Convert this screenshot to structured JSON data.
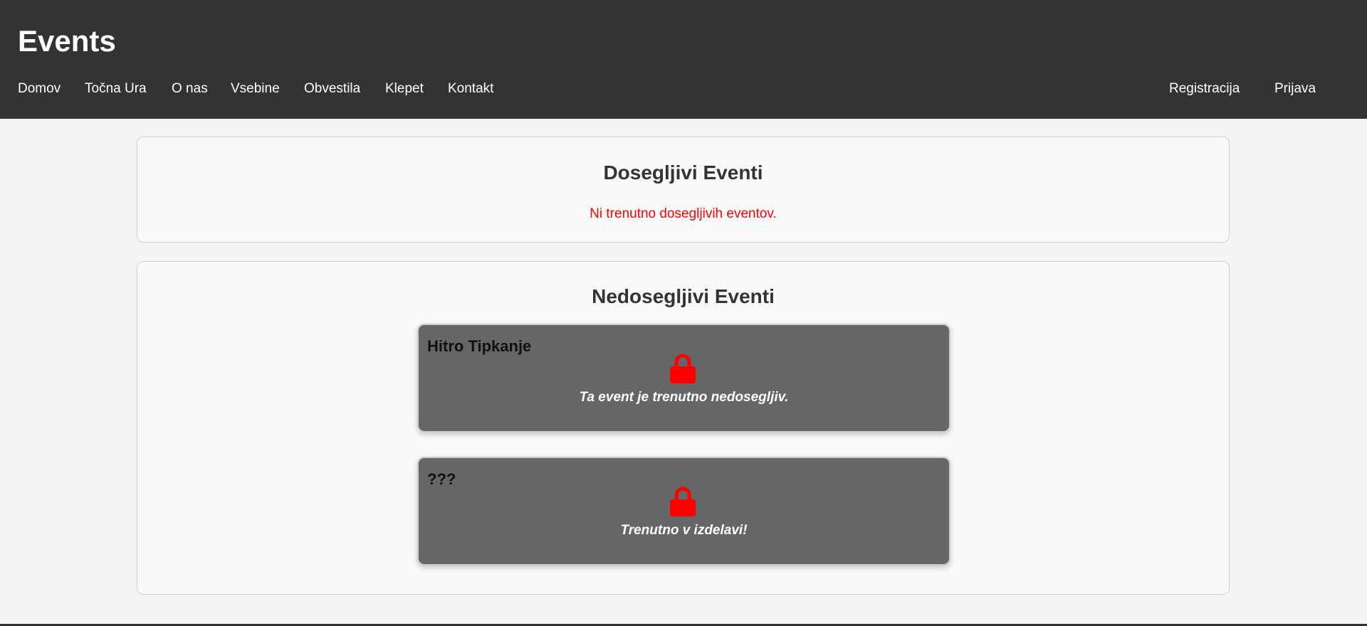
{
  "header": {
    "title": "Events",
    "nav": [
      "Domov",
      "Točna Ura",
      "O nas",
      "Vsebine",
      "Obvestila",
      "Klepet",
      "Kontakt"
    ],
    "auth": [
      "Registracija",
      "Prijava"
    ]
  },
  "available": {
    "title": "Dosegljivi Eventi",
    "empty_message": "Ni trenutno dosegljivih eventov."
  },
  "unavailable": {
    "title": "Nedosegljivi Eventi",
    "events": [
      {
        "name": "Hitro Tipkanje",
        "icon": "lock-icon",
        "message": "Ta event je trenutno nedosegljiv."
      },
      {
        "name": "???",
        "icon": "lock-icon",
        "message": "Trenutno v izdelavi!"
      }
    ]
  },
  "colors": {
    "header": "#333333",
    "lock": "#ff0000",
    "card": "#666666",
    "empty_message": "#ff0000"
  }
}
